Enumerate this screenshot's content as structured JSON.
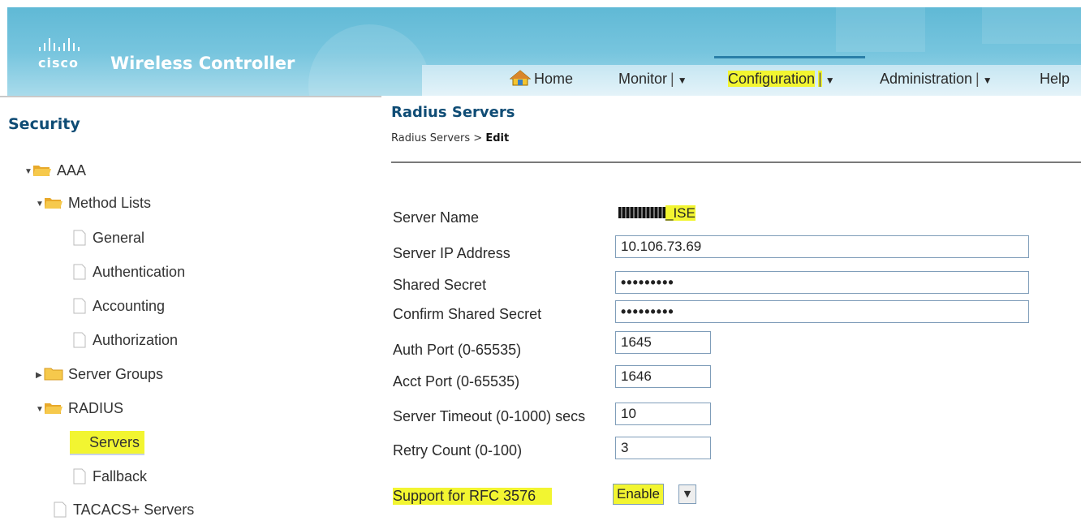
{
  "header": {
    "logo_text": "cisco",
    "product_title": "Wireless Controller",
    "nav": {
      "home": "Home",
      "monitor": "Monitor",
      "configuration": "Configuration",
      "administration": "Administration",
      "help": "Help"
    }
  },
  "sidebar": {
    "title": "Security",
    "items": {
      "aaa": "AAA",
      "method_lists": "Method Lists",
      "general": "General",
      "authentication": "Authentication",
      "accounting": "Accounting",
      "authorization": "Authorization",
      "server_groups": "Server Groups",
      "radius": "RADIUS",
      "servers": "Servers",
      "fallback": "Fallback",
      "tacacs": "TACACS+ Servers"
    }
  },
  "main": {
    "title": "Radius Servers",
    "breadcrumb": {
      "parent": "Radius Servers",
      "separator": ">",
      "current": "Edit"
    },
    "form": {
      "server_name_label": "Server Name",
      "server_name_value": "_ISE",
      "server_ip_label": "Server IP Address",
      "server_ip_value": "10.106.73.69",
      "shared_secret_label": "Shared Secret",
      "shared_secret_value": "•••••••••",
      "confirm_secret_label": "Confirm Shared Secret",
      "confirm_secret_value": "•••••••••",
      "auth_port_label": "Auth Port (0-65535)",
      "auth_port_value": "1645",
      "acct_port_label": "Acct Port (0-65535)",
      "acct_port_value": "1646",
      "timeout_label": "Server Timeout (0-1000) secs",
      "timeout_value": "10",
      "retry_label": "Retry Count (0-100)",
      "retry_value": "3",
      "rfc_label": "Support for RFC 3576",
      "rfc_value": "Enable"
    }
  },
  "colors": {
    "header_blue": "#6fc0da",
    "title_blue": "#0f4c75",
    "highlight": "#f2f531"
  }
}
